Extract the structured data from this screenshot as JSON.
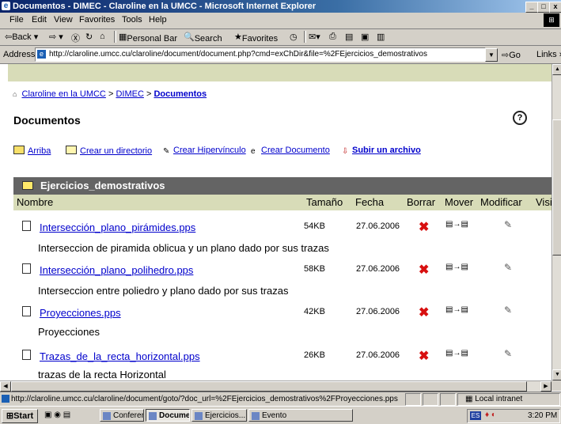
{
  "window": {
    "title": "Documentos - DIMEC - Claroline en la UMCC - Microsoft Internet Explorer",
    "minimize": "_",
    "maximize": "□",
    "close": "x"
  },
  "menu": [
    "File",
    "Edit",
    "View",
    "Favorites",
    "Tools",
    "Help"
  ],
  "toolbar": {
    "back": "⇦Back ▾",
    "forward": "⇨ ▾",
    "stop": "Ⓧ",
    "refresh": "↻",
    "home": "⌂",
    "personal_bar": "Personal Bar",
    "search": "Search",
    "favorites": "Favorites",
    "history": "◷"
  },
  "address": {
    "label": "Address",
    "url": "http://claroline.umcc.cu/claroline/document/document.php?cmd=exChDir&file=%2FEjercicios_demostrativos",
    "go": "Go",
    "links": "Links »"
  },
  "page": {
    "breadcrumb": {
      "home": "Claroline en la UMCC",
      "sep1": ">",
      "dept": "DIMEC",
      "sep2": ">",
      "current": "Documentos"
    },
    "title": "Documentos",
    "help": "?",
    "actions": {
      "up": "Arriba",
      "create_dir": "Crear un directorio",
      "create_link": "Crear Hipervínculo",
      "create_doc": "Crear Documento",
      "upload": "Subir un archivo"
    },
    "current_dir": "Ejercicios_demostrativos",
    "columns": {
      "name": "Nombre",
      "size": "Tamaño",
      "date": "Fecha",
      "delete": "Borrar",
      "move": "Mover",
      "modify": "Modificar",
      "visibility": "Visi"
    },
    "files": [
      {
        "name": "Intersección_plano_pirámides.pps",
        "size": "54KB",
        "date": "27.06.2006",
        "description": "Interseccion de piramida oblicua y un plano dado por sus trazas"
      },
      {
        "name": "Intersección_plano_polihedro.pps",
        "size": "58KB",
        "date": "27.06.2006",
        "description": "Interseccion entre poliedro y plano dado por sus trazas"
      },
      {
        "name": "Proyecciones.pps",
        "size": "42KB",
        "date": "27.06.2006",
        "description": "Proyecciones"
      },
      {
        "name": "Trazas_de_la_recta_horizontal.pps",
        "size": "26KB",
        "date": "27.06.2006",
        "description": "trazas de la recta Horizontal"
      }
    ],
    "delete_icon": "✖",
    "move_icon": "▤→▤",
    "edit_icon": "✎"
  },
  "status": {
    "text": "http://claroline.umcc.cu/claroline/document/goto/?doc_url=%2FEjercicios_demostrativos%2FProyecciones.pps",
    "zone": "Local intranet"
  },
  "taskbar": {
    "start": "Start",
    "tasks": [
      {
        "label": "Conferen...",
        "active": false
      },
      {
        "label": "Docume...",
        "active": true
      },
      {
        "label": "Ejercicios...",
        "active": false
      },
      {
        "label": "Evento",
        "active": false
      }
    ],
    "lang": "ES",
    "clock": "3:20 PM"
  }
}
